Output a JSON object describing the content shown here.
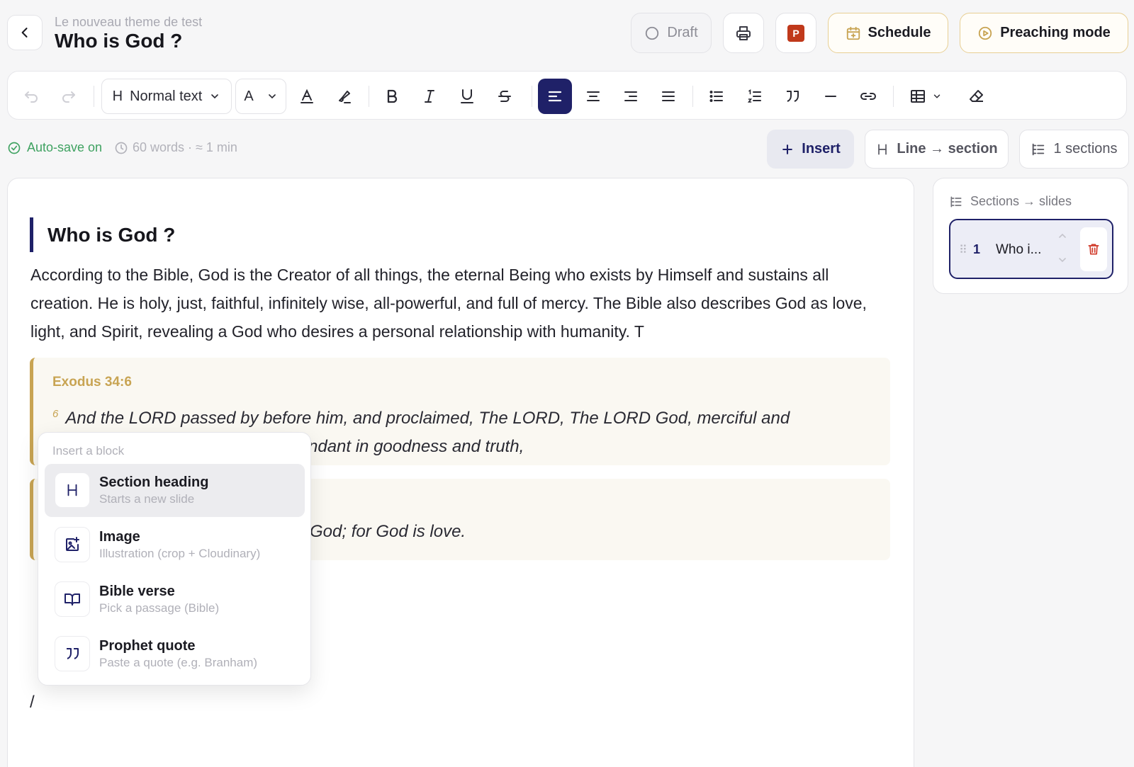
{
  "header": {
    "breadcrumb": "Le nouveau theme de test",
    "title": "Who is God ?",
    "draft_label": "Draft",
    "ppt_badge": "P",
    "schedule_label": "Schedule",
    "preaching_label": "Preaching mode"
  },
  "toolbar": {
    "style_select": "Normal text",
    "style_prefix": "H",
    "font_select": "A"
  },
  "status": {
    "autosave": "Auto-save on",
    "word_count": "60 words · ≈ 1 min",
    "insert_label": "Insert",
    "line_section_label": "Line → section",
    "sections_label": "1 sections"
  },
  "editor": {
    "heading": "Who is God ?",
    "paragraph": "According to the Bible, God is the Creator of all things, the eternal Being who exists by Himself and sustains all creation. He is holy, just, faithful, infinitely wise, all-powerful, and full of mercy. The Bible also describes God as love, light, and Spirit, revealing a God who desires a personal relationship with humanity. T",
    "verse1": {
      "reference": "Exodus 34:6",
      "number": "6",
      "text_line1": "And the LORD passed by before him, and proclaimed, The LORD, The LORD God, merciful and",
      "text_line2": "ndant in goodness and truth,"
    },
    "verse2": {
      "text": "God; for God is love."
    },
    "slash": "/"
  },
  "insert_menu": {
    "title": "Insert a block",
    "items": [
      {
        "label": "Section heading",
        "sub": "Starts a new slide",
        "icon": "heading-icon"
      },
      {
        "label": "Image",
        "sub": "Illustration (crop + Cloudinary)",
        "icon": "image-add-icon"
      },
      {
        "label": "Bible verse",
        "sub": "Pick a passage (Bible)",
        "icon": "book-icon"
      },
      {
        "label": "Prophet quote",
        "sub": "Paste a quote (e.g. Branham)",
        "icon": "quote-icon"
      }
    ]
  },
  "sections_panel": {
    "title": "Sections → slides",
    "items": [
      {
        "number": "1",
        "name": "Who i..."
      }
    ]
  },
  "colors": {
    "accent": "#1f2168",
    "gold": "#c8a453",
    "green": "#3fa261",
    "danger": "#d03a2a"
  }
}
